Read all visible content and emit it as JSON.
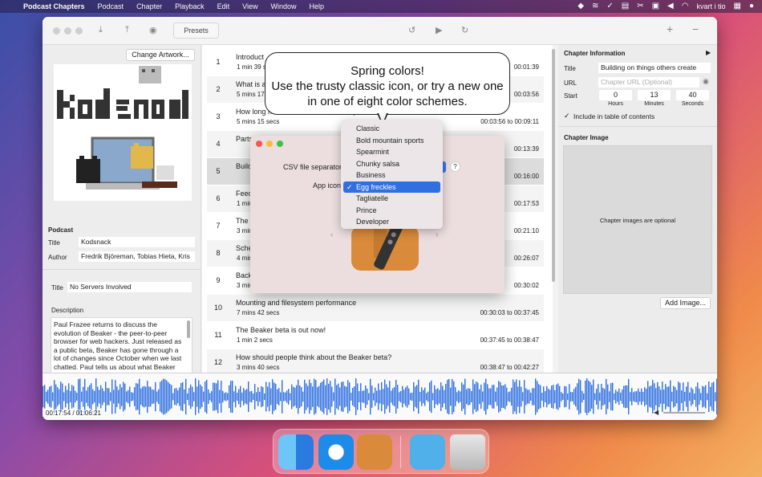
{
  "menubar": {
    "app": "Podcast Chapters",
    "items": [
      "Podcast",
      "Chapter",
      "Playback",
      "Edit",
      "View",
      "Window",
      "Help"
    ],
    "clock": "kvart i tio"
  },
  "toolbar": {
    "presets_label": "Presets"
  },
  "left": {
    "change_artwork": "Change Artwork...",
    "podcast_section": "Podcast",
    "title_label": "Title",
    "title_value": "Kodsnack",
    "author_label": "Author",
    "author_value": "Fredrik Björeman, Tobias Hieta, Kris",
    "episode_title_label": "Title",
    "episode_title_value": "No Servers Involved",
    "description_label": "Description",
    "description_text": "Paul Frazee returns to discuss the evolution of Beaker - the peer-to-peer browser for web hackers. Just released as a public beta, Beaker has gone through a lot of changes since October when we last chatted. Paul tells us about what Beaker is and some of the important concepts, such as feeds, the file system, and starting to create things on top of them"
  },
  "chapters": [
    {
      "num": "1",
      "title": "Introduct",
      "duration": "1 min 39 s",
      "time": "00:01:39"
    },
    {
      "num": "2",
      "title": "What is a",
      "duration": "5 mins 17",
      "time": "00:03:56"
    },
    {
      "num": "3",
      "title": "How long has Beaker been in development?",
      "duration": "5 mins 15 secs",
      "time": "00:03:56 to 00:09:11"
    },
    {
      "num": "4",
      "title": "Parts",
      "duration": "",
      "time": "00:13:39"
    },
    {
      "num": "5",
      "title": "Build",
      "duration": "",
      "time": "00:16:00"
    },
    {
      "num": "6",
      "title": "Feed",
      "duration": "1 min",
      "time": "00:17:53"
    },
    {
      "num": "7",
      "title": "The",
      "duration": "3 min",
      "time": "00:21:10"
    },
    {
      "num": "8",
      "title": "Sche",
      "duration": "4 min",
      "time": "00:26:07"
    },
    {
      "num": "9",
      "title": "Back",
      "duration": "3 min",
      "time": "00:30:02"
    },
    {
      "num": "10",
      "title": "Mounting and filesystem performance",
      "duration": "7 mins 42 secs",
      "time": "00:30:03 to 00:37:45"
    },
    {
      "num": "11",
      "title": "The Beaker beta is out now!",
      "duration": "1 min 2 secs",
      "time": "00:37:45 to 00:38:47"
    },
    {
      "num": "12",
      "title": "How should people think about the Beaker beta?",
      "duration": "3 mins 40 secs",
      "time": "00:38:47 to 00:42:27"
    }
  ],
  "right": {
    "chapter_info": "Chapter Information",
    "title_label": "Title",
    "title_value": "Building on things others create",
    "url_label": "URL",
    "url_placeholder": "Chapter URL (Optional)",
    "start_label": "Start",
    "hours": "0",
    "minutes": "13",
    "seconds": "40",
    "hours_label": "Hours",
    "minutes_label": "Minutes",
    "seconds_label": "Seconds",
    "include_toc": "Include in table of contents",
    "chapter_image": "Chapter Image",
    "image_hint": "Chapter images are optional",
    "add_image": "Add Image..."
  },
  "waveform": {
    "time_display": "00:17:54 / 01:06:21"
  },
  "prefs": {
    "csv_label": "CSV file separator",
    "help": "?",
    "app_icon_label": "App icon"
  },
  "callout": {
    "line1": "Spring colors!",
    "line2": "Use the trusty classic icon, or try a new one",
    "line3": "in one of eight color schemes."
  },
  "icon_menu": {
    "options": [
      "Classic",
      "Bold mountain sports",
      "Spearmint",
      "Chunky salsa",
      "Business",
      "Egg freckles",
      "Tagliatelle",
      "Prince",
      "Developer"
    ],
    "selected": "Egg freckles",
    "check": "✓"
  },
  "colors": {
    "accent": "#2f6fe0",
    "wave": "#2f6fe0"
  }
}
